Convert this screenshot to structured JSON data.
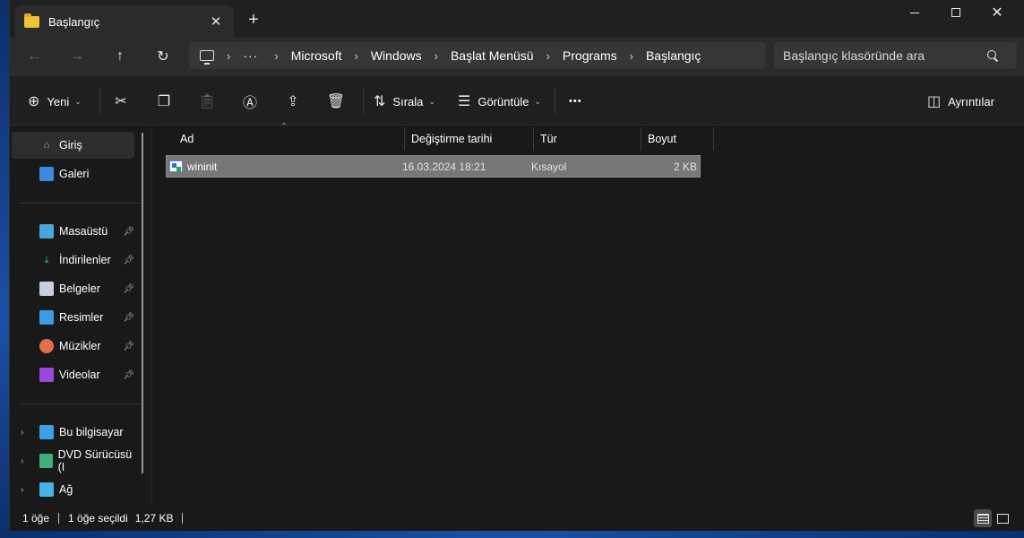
{
  "window": {
    "tab_title": "Başlangıç",
    "tab_close": "✕",
    "new_tab": "+",
    "minimize": "",
    "close": "✕"
  },
  "nav": {
    "back": "←",
    "forward": "→",
    "up": "↑",
    "refresh": "↻",
    "ellipsis": "···",
    "breadcrumb": [
      "Microsoft",
      "Windows",
      "Başlat Menüsü",
      "Programs",
      "Başlangıç"
    ],
    "search_placeholder": "Başlangıç klasöründe ara"
  },
  "commands": {
    "new_label": "Yeni",
    "sort_label": "Sırala",
    "view_label": "Görüntüle",
    "more": "•••",
    "details_label": "Ayrıntılar"
  },
  "sidebar": {
    "items": [
      {
        "label": "Giriş",
        "icon": "home-icon"
      },
      {
        "label": "Galeri",
        "icon": "gallery-icon"
      },
      {
        "label": "Masaüstü",
        "icon": "desktop-icon"
      },
      {
        "label": "İndirilenler",
        "icon": "downloads-icon"
      },
      {
        "label": "Belgeler",
        "icon": "documents-icon"
      },
      {
        "label": "Resimler",
        "icon": "pictures-icon"
      },
      {
        "label": "Müzikler",
        "icon": "music-icon"
      },
      {
        "label": "Videolar",
        "icon": "videos-icon"
      },
      {
        "label": "Bu bilgisayar",
        "icon": "this-pc-icon"
      },
      {
        "label": "DVD Sürücüsü (I",
        "icon": "dvd-drive-icon"
      },
      {
        "label": "Ağ",
        "icon": "network-icon"
      }
    ]
  },
  "filelist": {
    "columns": [
      "Ad",
      "Değiştirme tarihi",
      "Tür",
      "Boyut"
    ],
    "rows": [
      {
        "name": "wininit",
        "modified": "16.03.2024 18:21",
        "type": "Kısayol",
        "size": "2 KB"
      }
    ]
  },
  "status": {
    "item_count": "1 öğe",
    "selected": "1 öğe seçildi",
    "selected_size": "1,27 KB"
  },
  "colors": {
    "window_bg": "#191919",
    "toolbar_bg": "#2b2b2b",
    "selection": "#777777",
    "folder": "#f3c23a"
  }
}
